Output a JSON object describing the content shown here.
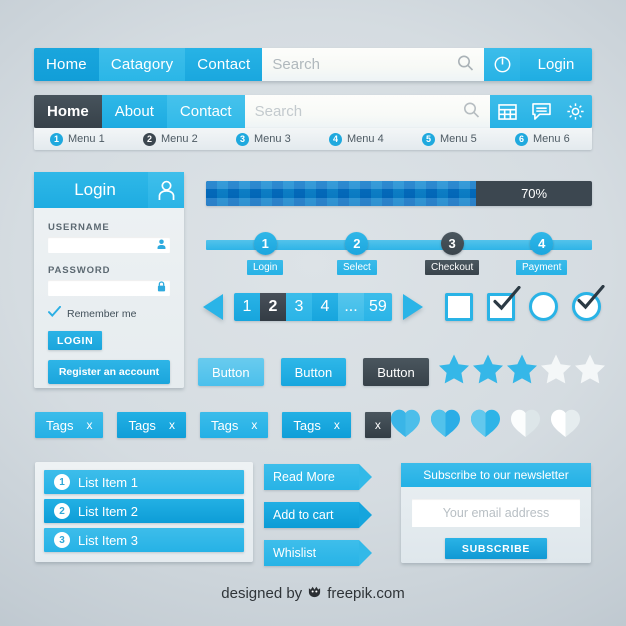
{
  "nav1": {
    "tabs": [
      "Home",
      "Catagory",
      "Contact"
    ],
    "search_placeholder": "Search",
    "search_icon": "search-icon",
    "power_icon": "power-icon",
    "login_label": "Login"
  },
  "nav2": {
    "tabs": [
      "Home",
      "About",
      "Contact"
    ],
    "search_placeholder": "Search",
    "search_icon": "search-icon",
    "icons": [
      "table-icon",
      "chat-icon",
      "gear-icon"
    ]
  },
  "submenu": {
    "items": [
      {
        "num": "1",
        "label": "Menu 1"
      },
      {
        "num": "2",
        "label": "Menu 2"
      },
      {
        "num": "3",
        "label": "Menu 3"
      },
      {
        "num": "4",
        "label": "Menu 4"
      },
      {
        "num": "5",
        "label": "Menu 5"
      },
      {
        "num": "6",
        "label": "Menu 6"
      }
    ]
  },
  "login_panel": {
    "title": "Login",
    "avatar_icon": "user-icon",
    "username_label": "USERNAME",
    "username_value": "",
    "username_icon": "user-icon",
    "password_label": "PASSWORD",
    "password_value": "",
    "password_icon": "lock-icon",
    "remember_label": "Remember me",
    "remember_icon": "check-icon",
    "login_button": "LOGIN",
    "register_button": "Register an account"
  },
  "progress": {
    "percent_label": "70%",
    "percent_value": 70
  },
  "steps": [
    {
      "num": "1",
      "label": "Login",
      "active": false
    },
    {
      "num": "2",
      "label": "Select",
      "active": false
    },
    {
      "num": "3",
      "label": "Checkout",
      "active": true
    },
    {
      "num": "4",
      "label": "Payment",
      "active": false
    }
  ],
  "pagination": {
    "prev_icon": "triangle-left-icon",
    "next_icon": "triangle-right-icon",
    "pages": [
      "1",
      "2",
      "3",
      "4",
      "...",
      "59"
    ],
    "current": "2"
  },
  "selectors": {
    "checkbox_empty": "checkbox-unchecked-icon",
    "checkbox_checked": "checkbox-checked-icon",
    "radio_empty": "radio-unchecked-icon",
    "radio_checked": "radio-checked-icon"
  },
  "buttons": [
    {
      "label": "Button",
      "style": "light"
    },
    {
      "label": "Button",
      "style": "mid"
    },
    {
      "label": "Button",
      "style": "dark"
    }
  ],
  "rating": {
    "filled": 3,
    "total": 5,
    "star_icon": "star-icon"
  },
  "tags": [
    {
      "label": "Tags",
      "close": "x"
    },
    {
      "label": "Tags",
      "close": "x"
    },
    {
      "label": "Tags",
      "close": "x"
    },
    {
      "label": "Tags",
      "close": "x"
    },
    {
      "label": "",
      "close": "x"
    }
  ],
  "hearts": {
    "filled": 3,
    "total": 5,
    "heart_icon": "heart-icon"
  },
  "list": [
    {
      "num": "1",
      "label": "List Item 1"
    },
    {
      "num": "2",
      "label": "List Item 2"
    },
    {
      "num": "3",
      "label": "List Item 3"
    }
  ],
  "arrow_buttons": [
    {
      "label": "Read More"
    },
    {
      "label": "Add to cart"
    },
    {
      "label": "Whislist"
    }
  ],
  "newsletter": {
    "title": "Subscribe to our newsletter",
    "email_placeholder": "Your email address",
    "email_value": "",
    "submit_label": "SUBSCRIBE"
  },
  "footer": {
    "prefix": "designed by",
    "brand": "freepik.com",
    "logo_icon": "freepik-crown-icon"
  },
  "colors": {
    "accent": "#22b0e5",
    "accent_light": "#4bc0ec",
    "accent_dark": "#0f9ed8",
    "dark": "#3a444c",
    "panel": "#eaf0f3",
    "white": "#ffffff"
  }
}
